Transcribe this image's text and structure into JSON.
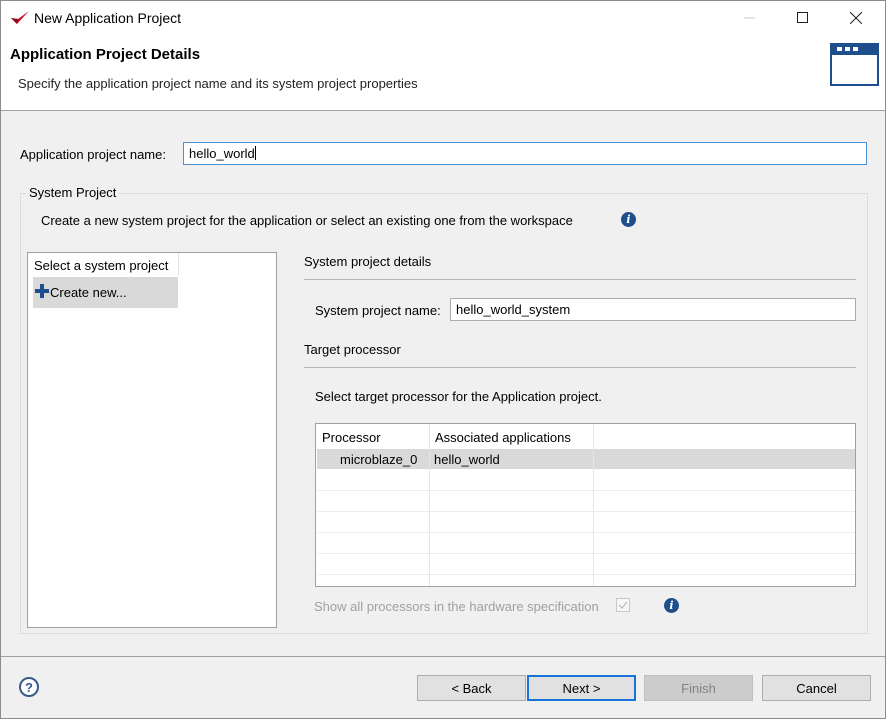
{
  "window": {
    "title": "New Application Project",
    "controls": {
      "minimize": "minimize",
      "maximize": "maximize",
      "close": "close"
    }
  },
  "header": {
    "title": "Application Project Details",
    "description": "Specify the application project name and its system project properties",
    "icon": "window-dialog-icon"
  },
  "app_name": {
    "label": "Application project name:",
    "value": "hello_world"
  },
  "system_project": {
    "group_title": "System Project",
    "description": "Create a new system project for the application or select an existing one from the workspace",
    "list": {
      "header": "Select a system project",
      "items": [
        {
          "label": "Create new...",
          "icon": "plus-icon",
          "selected": true
        }
      ]
    },
    "details": {
      "title": "System project details",
      "name_label": "System project name:",
      "name_value": "hello_world_system"
    },
    "target": {
      "title": "Target processor",
      "description": "Select target processor for the Application project.",
      "columns": [
        "Processor",
        "Associated applications",
        ""
      ],
      "rows": [
        {
          "processor": "microblaze_0",
          "applications": "hello_world",
          "selected": true
        }
      ]
    },
    "show_all": {
      "label": "Show all processors in the hardware specification",
      "checked": true,
      "enabled": false
    }
  },
  "footer": {
    "help": "?",
    "buttons": {
      "back": "< Back",
      "next": "Next >",
      "finish": "Finish",
      "cancel": "Cancel"
    }
  },
  "colors": {
    "accent": "#1e4f8c",
    "focus": "#1a73d9",
    "brand_red": "#c8102e",
    "selection": "#d9d9d9"
  }
}
